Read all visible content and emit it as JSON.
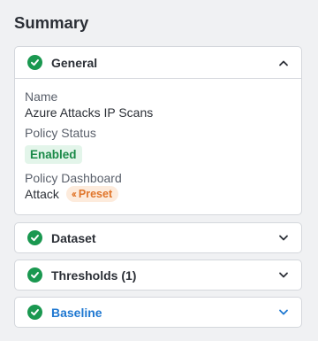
{
  "page": {
    "title": "Summary"
  },
  "sections": [
    {
      "label": "General",
      "expanded": true,
      "status_icon": "check-circle-icon",
      "chevron": "chevron-up-icon",
      "fields": {
        "name_label": "Name",
        "name_value": "Azure Attacks IP Scans",
        "status_label": "Policy Status",
        "status_value": "Enabled",
        "dashboard_label": "Policy Dashboard",
        "dashboard_value": "Attack",
        "preset_badge": "Preset",
        "preset_icon": "double-chevron-left-icon"
      }
    },
    {
      "label": "Dataset",
      "expanded": false,
      "status_icon": "check-circle-icon",
      "chevron": "chevron-down-icon"
    },
    {
      "label": "Thresholds (1)",
      "expanded": false,
      "status_icon": "check-circle-icon",
      "chevron": "chevron-down-icon"
    },
    {
      "label": "Baseline",
      "expanded": false,
      "active": true,
      "status_icon": "check-circle-icon",
      "chevron": "chevron-down-icon"
    }
  ],
  "colors": {
    "success_green": "#1a9850",
    "link_blue": "#1f78d1",
    "preset_orange": "#e0752a",
    "background": "#f0f1f3"
  }
}
